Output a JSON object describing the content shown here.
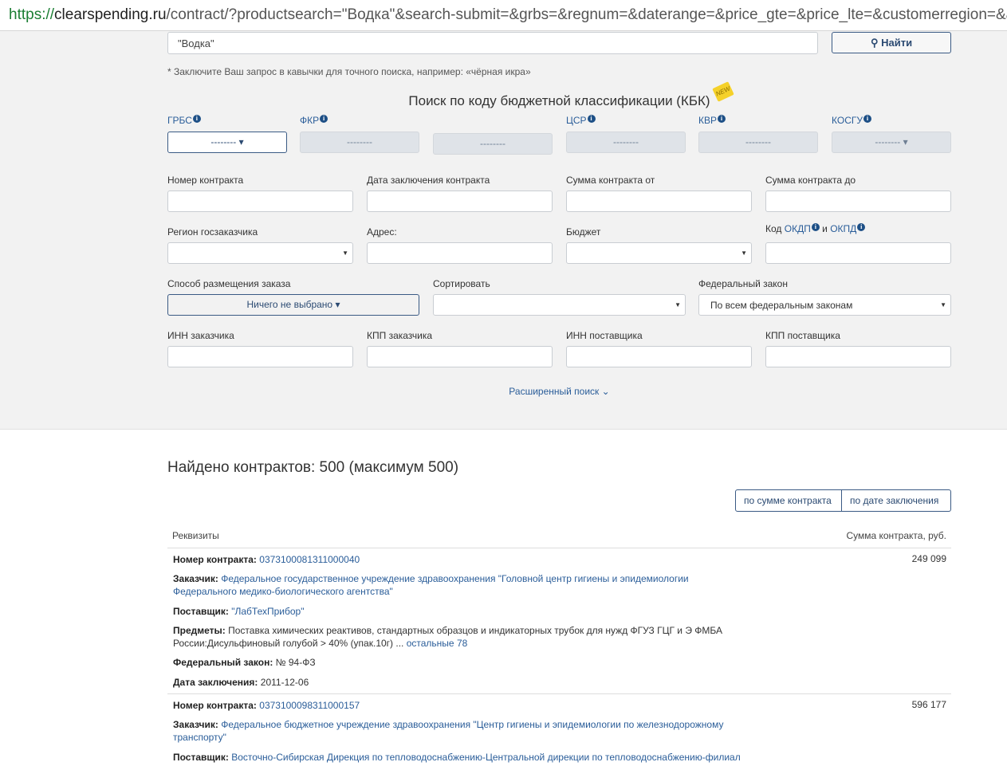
{
  "browser": {
    "url_scheme": "https://",
    "url_host": "clearspending.ru",
    "url_rest": "/contract/?productsearch=\"Водка\"&search-submit=&grbs=&regnum=&daterange=&price_gte=&price_lte=&customerregion=&address="
  },
  "search": {
    "value": "\"Водка\"",
    "button_label": "Найти",
    "hint": "* Заключите Ваш запрос в кавычки для точного поиска, например: «чёрная икра»"
  },
  "kbk": {
    "title": "Поиск по коду бюджетной классификации (КБК)",
    "badge": "NEW",
    "labels": {
      "grbs": "ГРБС",
      "fkr": "ФКР",
      "csr": "ЦСР",
      "kvr": "КВР",
      "kosgu": "КОСГУ"
    },
    "selects": [
      "--------",
      "--------",
      "--------",
      "--------",
      "--------",
      "--------"
    ]
  },
  "form": {
    "contract_number": "Номер контракта",
    "contract_date": "Дата заключения контракта",
    "sum_from": "Сумма контракта от",
    "sum_to": "Сумма контракта до",
    "region": "Регион госзаказчика",
    "address": "Адрес:",
    "budget": "Бюджет",
    "code_prefix": "Код",
    "okdp": "ОКДП",
    "and": "и",
    "okpd": "ОКПД",
    "placement_label": "Способ размещения заказа",
    "placement_value": "Ничего не выбрано",
    "sort_label": "Сортировать",
    "law_label": "Федеральный закон",
    "law_value": "По всем федеральным законам",
    "inn_customer": "ИНН заказчика",
    "kpp_customer": "КПП заказчика",
    "inn_supplier": "ИНН поставщика",
    "kpp_supplier": "КПП поставщика",
    "advanced": "Расширенный поиск"
  },
  "results": {
    "title": "Найдено контрактов: 500 (максимум 500)",
    "sort_by_sum": "по сумме контракта",
    "sort_by_date": "по дате заключения",
    "col_details": "Реквизиты",
    "col_sum": "Сумма контракта, руб.",
    "labels": {
      "number": "Номер контракта:",
      "customer": "Заказчик:",
      "supplier": "Поставщик:",
      "subjects": "Предметы:",
      "law": "Федеральный закон:",
      "date": "Дата заключения:"
    },
    "items": [
      {
        "number": "0373100081311000040",
        "amount": "249 099",
        "customer_line1": "Федеральное государственное учреждение здравоохранения \"Головной центр гигиены и эпидемиологии",
        "customer_line2": "Федерального медико-биологического агентства\"",
        "supplier": "\"ЛабТехПрибор\"",
        "subjects_line1": "Поставка химических реактивов, стандартных образцов и индикаторных трубок для нужд ФГУЗ ГЦГ и Э ФМБА",
        "subjects_line2": "России:Дисульфиновый голубой > 40% (упак.10г) ...",
        "subjects_more": "остальные 78",
        "law": "№ 94-ФЗ",
        "date": "2011-12-06"
      },
      {
        "number": "0373100098311000157",
        "amount": "596 177",
        "customer_line1": "Федеральное бюджетное учреждение здравоохранения \"Центр гигиены и эпидемиологии по железнодорожному",
        "customer_line2": "транспорту\"",
        "supplier": "Восточно-Сибирская Дирекция по тепловодоснабжению-Центральной дирекции по тепловодоснабжению-филиал"
      }
    ]
  }
}
